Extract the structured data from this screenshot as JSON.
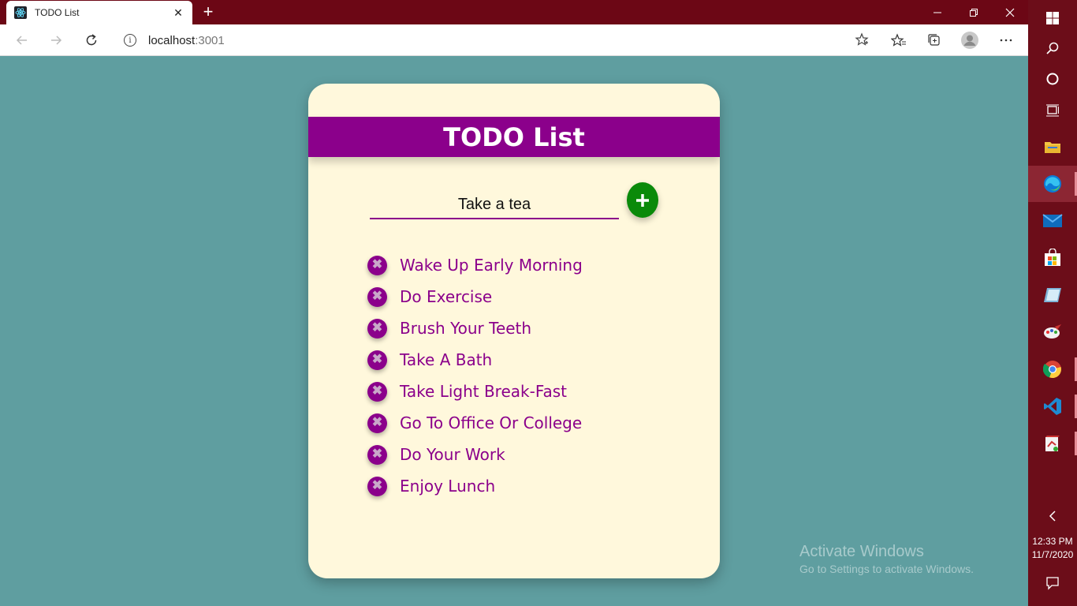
{
  "browser": {
    "tab_title": "TODO List",
    "address_host": "localhost",
    "address_port": ":3001"
  },
  "app": {
    "title": "TODO List",
    "input_value": "Take a tea",
    "add_label": "+",
    "items": [
      "Wake Up Early Morning",
      "Do Exercise",
      "Brush Your Teeth",
      "Take A Bath",
      "Take Light Break-Fast",
      "Go To Office Or College",
      "Do Your Work",
      "Enjoy Lunch"
    ],
    "delete_label": "✖"
  },
  "taskbar": {
    "time": "12:33 PM",
    "date": "11/7/2020"
  },
  "watermark": {
    "title": "Activate Windows",
    "subtitle": "Go to Settings to activate Windows."
  },
  "colors": {
    "background": "#5f9ea0",
    "card": "#fff8dc",
    "accent": "#8b008b",
    "add_button": "#0a8a0a",
    "titlebar": "#6c0715"
  },
  "icons": [
    "react-icon",
    "back-icon",
    "forward-icon",
    "refresh-icon",
    "info-icon",
    "star-icon",
    "favorites-icon",
    "collections-icon",
    "profile-icon",
    "more-icon",
    "minimize-icon",
    "restore-icon",
    "close-icon",
    "windows-icon",
    "search-icon",
    "cortana-icon",
    "task-view-icon",
    "file-explorer-icon",
    "edge-icon",
    "mail-icon",
    "store-icon",
    "notepad-icon",
    "paint-icon",
    "chrome-icon",
    "vscode-icon",
    "app-icon",
    "chevron-left-icon",
    "notification-icon"
  ]
}
